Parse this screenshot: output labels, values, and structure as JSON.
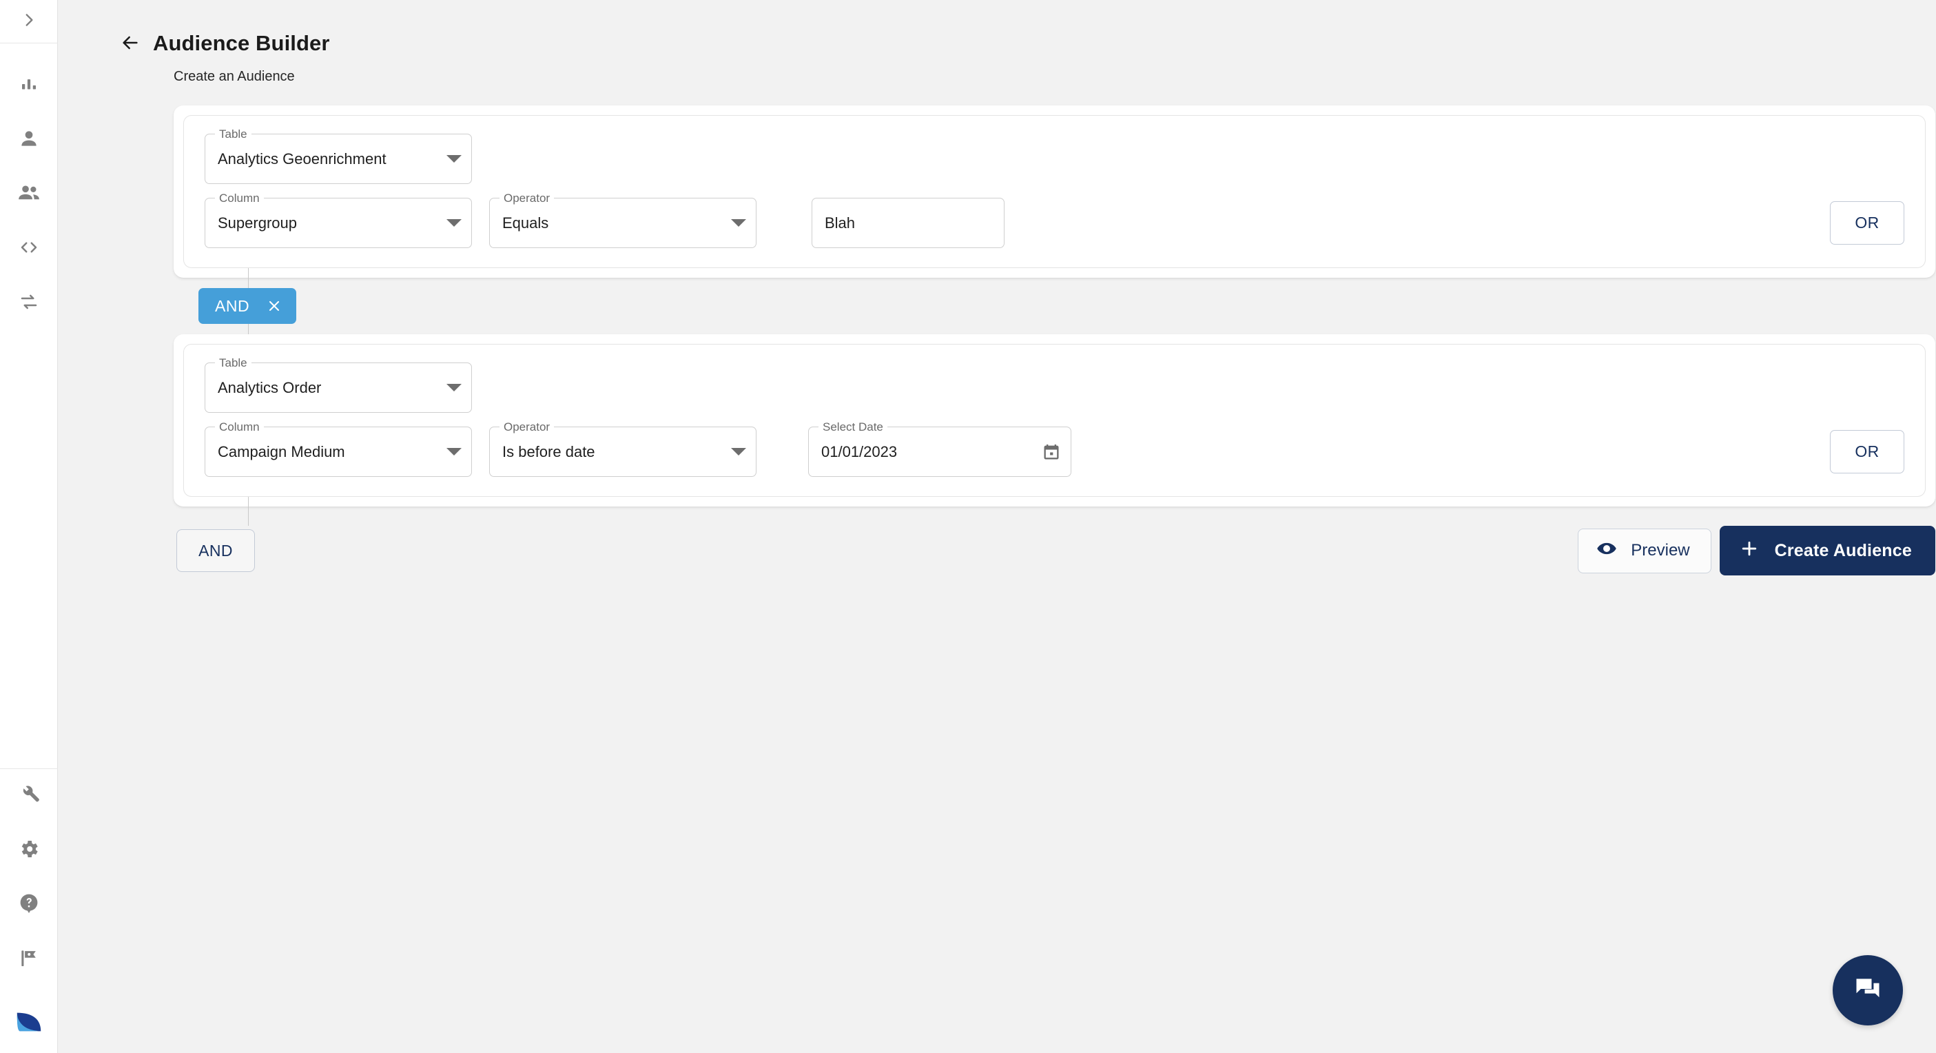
{
  "sidebar": {
    "toggle_icon": "chevron-right-icon",
    "top_items": [
      {
        "icon": "bar-chart-icon",
        "name": "analytics"
      },
      {
        "icon": "person-icon",
        "name": "profile"
      },
      {
        "icon": "people-icon",
        "name": "audiences"
      },
      {
        "icon": "code-icon",
        "name": "developer"
      },
      {
        "icon": "sync-arrows-icon",
        "name": "integrations"
      }
    ],
    "bottom_items": [
      {
        "icon": "wrench-icon",
        "name": "tools"
      },
      {
        "icon": "gear-icon",
        "name": "settings"
      },
      {
        "icon": "help-circle-icon",
        "name": "help"
      },
      {
        "icon": "flag-icon",
        "name": "feature-flags"
      }
    ],
    "logo": {
      "icon": "leaf-logo-icon",
      "name": "app-logo"
    }
  },
  "header": {
    "back_icon": "arrow-left-icon",
    "title": "Audience Builder",
    "subtitle": "Create an Audience"
  },
  "labels": {
    "table": "Table",
    "column": "Column",
    "operator": "Operator",
    "select_date": "Select Date"
  },
  "rules": [
    {
      "table": "Analytics Geoenrichment",
      "column": "Supergroup",
      "operator": "Equals",
      "value": "Blah",
      "value_placeholder": "",
      "or_label": "OR"
    },
    {
      "table": "Analytics Order",
      "column": "Campaign Medium",
      "operator": "Is before date",
      "date": "01/01/2023",
      "or_label": "OR"
    }
  ],
  "group_connector": {
    "label": "AND",
    "remove_icon": "close-icon"
  },
  "footer": {
    "and_label": "AND",
    "preview_label": "Preview",
    "preview_icon": "eye-icon",
    "create_label": "Create Audience",
    "create_icon": "plus-icon"
  },
  "fab": {
    "icon": "chat-bubbles-icon",
    "name": "support-chat"
  },
  "colors": {
    "navy": "#17305e",
    "chip_blue": "#459fd9",
    "background": "#f2f2f2",
    "card": "#ffffff",
    "border": "#cfcfcf"
  }
}
